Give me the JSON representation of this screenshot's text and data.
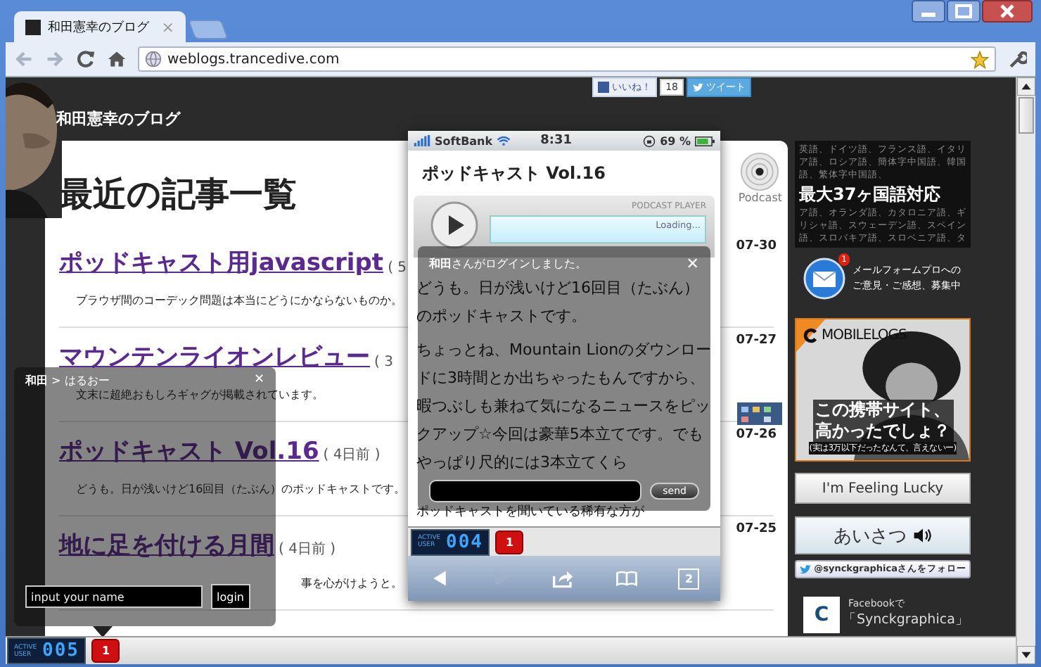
{
  "browser": {
    "tab_title": "和田憲幸のブログ",
    "tab_close": "×",
    "address": "weblogs.trancedive.com"
  },
  "header": {
    "site_title": "和田憲幸のブログ",
    "like_label": "いいね！",
    "like_count": "18",
    "tweet_label": "ツイート"
  },
  "main": {
    "heading": "最近の記事一覧",
    "podcast_label": "Podcast",
    "articles": [
      {
        "title": "ポッドキャスト用javascript",
        "meta": "( 5",
        "date": "07-30",
        "excerpt": "ブラウザ間のコーデック問題は本当にどうにかならないものか。"
      },
      {
        "title": "マウンテンライオンレビュー",
        "meta": "( 3",
        "date": "07-27",
        "excerpt": "文末に超絶おもしろギャグが掲載されています。"
      },
      {
        "title": "ポッドキャスト Vol.16",
        "meta": "( 4日前 )",
        "date": "07-26",
        "excerpt": "どうも。日が浅いけど16回目（たぶん）のポッドキャストです。"
      },
      {
        "title": "地に足を付ける月間",
        "meta": "( 4日前 )",
        "date": "07-25",
        "excerpt": "事を心がけようと。"
      }
    ]
  },
  "phone": {
    "carrier": "SoftBank",
    "time": "8:31",
    "battery": "69 %",
    "title": "ポッドキャスト Vol.16",
    "player_label": "PODCAST PLAYER",
    "player_status": "Loading...",
    "paragraphs": [
      "どうも。日が浅いけど16回目（たぶん）のポッドキャストです。",
      "ちょっとね、Mountain Lionのダウンロードに3時間とか出ちゃったもんですから、暇つぶしも兼ねて気になるニュースをピックアップ☆今回は豪華5本立てです。でもやっぱり尺的には3本立てくら"
    ],
    "last_line": "ポッドキャストを聞いている稀有な方が",
    "chat": {
      "message": "**和田**さんがログインしました。",
      "close": "✕",
      "send": "send"
    },
    "active_user": {
      "label": "ACTIVE USER",
      "count": "004",
      "badge": "1"
    },
    "tabs_count": "2"
  },
  "login_popup": {
    "path": "**和田** > はるおー",
    "close": "✕",
    "placeholder": "input your name",
    "button": "login"
  },
  "active_user": {
    "label": "ACTIVE USER",
    "count": "005",
    "badge": "1"
  },
  "sidebar": {
    "languages_top": "英語、ドイツ語、フランス語、イタリア語、ロシア語、簡体字中国語、韓国語、繁体字中国語、",
    "languages_headline": "最大37ヶ国語対応",
    "languages_bottom": "ア語、オランダ語、カタロニア語、ギリシャ語、スウェーデン語、スペイン語、スロバキア語、スロベニア語、タ",
    "mail_badge": "1",
    "mail_lines": [
      "メールフォームプロへの",
      "ご意見・ご感想、募集中"
    ],
    "mobilelogs": {
      "logo": "MOBILELOGS",
      "headline_lines": [
        "この携帯サイト、",
        "高かったでしょ？"
      ],
      "note": "(実は3万以下だったなんて、言えないー)"
    },
    "lucky_button": "I'm Feeling Lucky",
    "greeting_button": "あいさつ",
    "twitter_follow": "@synckgraphicaさんをフォロー",
    "facebook": {
      "logo": "C",
      "line1": "Facebookで",
      "line2": "「Synckgraphica」"
    }
  }
}
